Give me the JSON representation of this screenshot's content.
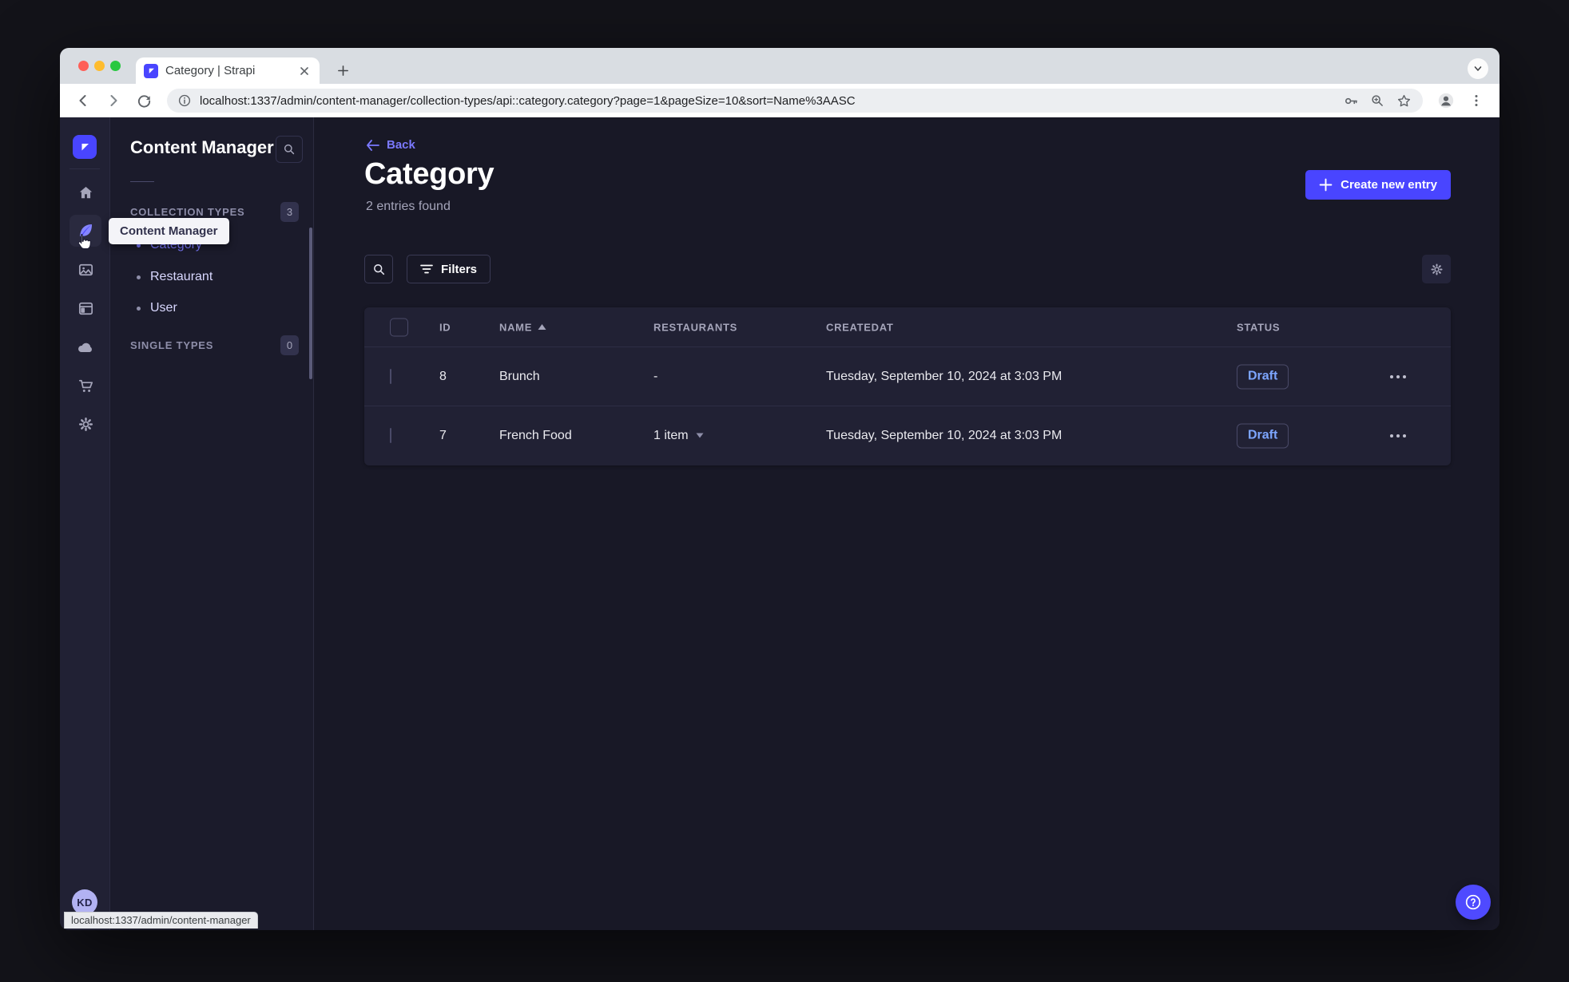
{
  "browser": {
    "tab_title": "Category | Strapi",
    "url": "localhost:1337/admin/content-manager/collection-types/api::category.category?page=1&pageSize=10&sort=Name%3AASC",
    "status_link": "localhost:1337/admin/content-manager"
  },
  "sidebar": {
    "tooltip": "Content Manager",
    "icons": [
      "strapi-logo",
      "home",
      "content-manager",
      "media-library",
      "content-type-builder",
      "cloud",
      "marketplace",
      "settings"
    ],
    "avatar_initials": "KD"
  },
  "subnav": {
    "title": "Content Manager",
    "search_icon": "magnifier",
    "collection_types_label": "COLLECTION TYPES",
    "collection_types_count": "3",
    "items": [
      {
        "label": "Category",
        "active": true
      },
      {
        "label": "Restaurant",
        "active": false
      },
      {
        "label": "User",
        "active": false
      }
    ],
    "single_types_label": "SINGLE TYPES",
    "single_types_count": "0"
  },
  "main": {
    "back": "Back",
    "title": "Category",
    "subtitle": "2 entries found",
    "create_button": "Create new entry",
    "filters_button": "Filters",
    "table": {
      "headers": {
        "id": "ID",
        "name": "NAME",
        "restaurants": "RESTAURANTS",
        "createdat": "CREATEDAT",
        "status": "STATUS"
      },
      "sort": {
        "column": "NAME",
        "direction": "asc"
      },
      "rows": [
        {
          "id": "8",
          "name": "Brunch",
          "restaurants": "-",
          "createdat": "Tuesday, September 10, 2024 at 3:03 PM",
          "status": "Draft"
        },
        {
          "id": "7",
          "name": "French Food",
          "restaurants": "1 item",
          "createdat": "Tuesday, September 10, 2024 at 3:03 PM",
          "status": "Draft"
        }
      ]
    },
    "icons": {
      "search": "magnifier",
      "filters": "filter-lines",
      "table_settings": "gear",
      "row_actions": "ellipsis",
      "help": "question-mark-circle",
      "sort": "triangle-up",
      "restaurants_caret": "triangle-down",
      "back": "arrow-left",
      "create": "plus"
    }
  },
  "colors": {
    "accent": "#4945ff",
    "accent_light": "#7b79ff",
    "draft_text": "#7da6ff",
    "panel": "#212134",
    "subnav_bg": "#1b1b2b",
    "content_bg": "#181826",
    "border": "#32324d",
    "chrome_strip": "#d9dde2"
  }
}
